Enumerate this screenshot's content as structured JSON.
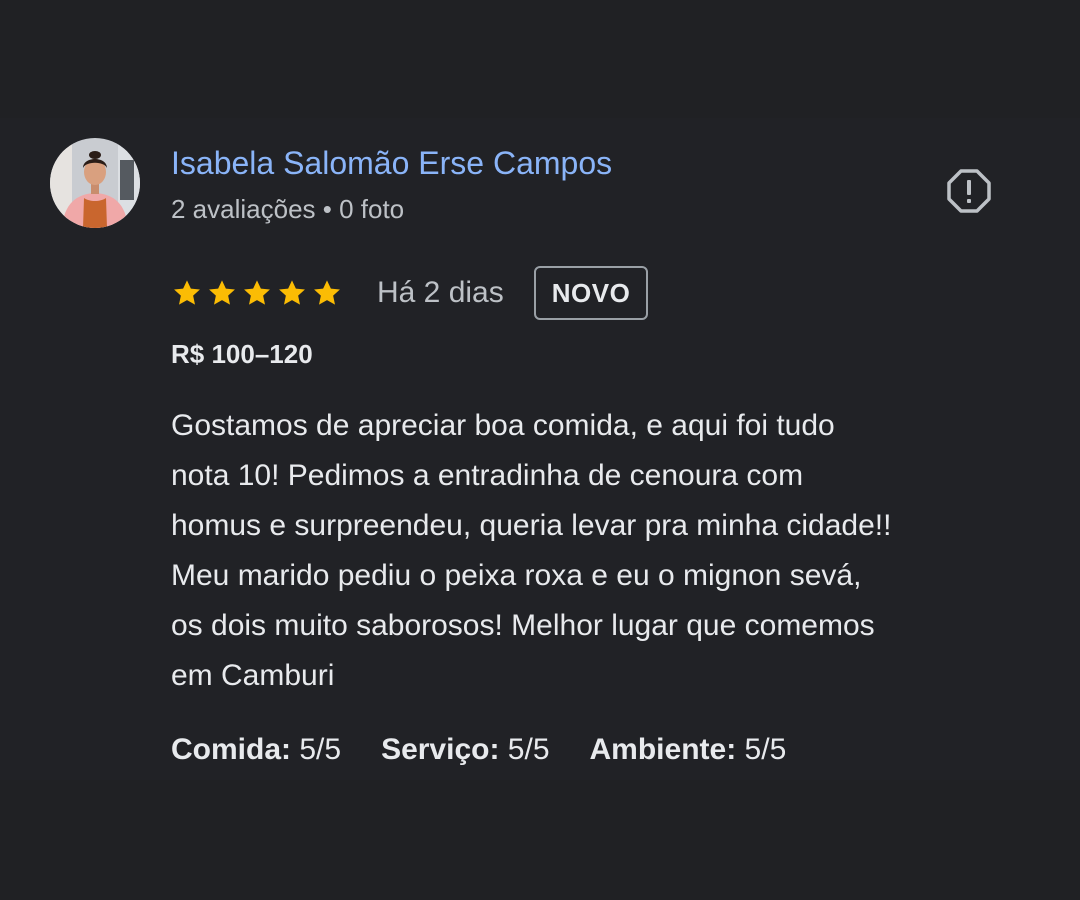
{
  "review": {
    "author": {
      "name": "Isabela Salomão Erse Campos",
      "meta": "2 avaliações • 0 foto"
    },
    "report_icon": "report-flag-icon",
    "rating": {
      "stars": 5,
      "max": 5,
      "star_color": "#fbbc04"
    },
    "date": "Há 2 dias",
    "badge": "NOVO",
    "price_range": "R$ 100–120",
    "text_lines": [
      "Gostamos de apreciar boa comida, e aqui foi tudo",
      "nota 10! Pedimos a entradinha de cenoura com",
      "homus e surpreendeu, queria levar pra minha cidade!!",
      "Meu marido pediu o peixa roxa e eu o mignon sevá,",
      "os dois muito saborosos! Melhor lugar que comemos",
      "em Camburi"
    ],
    "sub_ratings": [
      {
        "label": "Comida:",
        "value": "5/5"
      },
      {
        "label": "Serviço:",
        "value": "5/5"
      },
      {
        "label": "Ambiente:",
        "value": "5/5"
      }
    ]
  },
  "colors": {
    "background": "#202124",
    "author_name": "#8ab4f8",
    "secondary_text": "#bdc1c6",
    "primary_text": "#e8eaed"
  }
}
